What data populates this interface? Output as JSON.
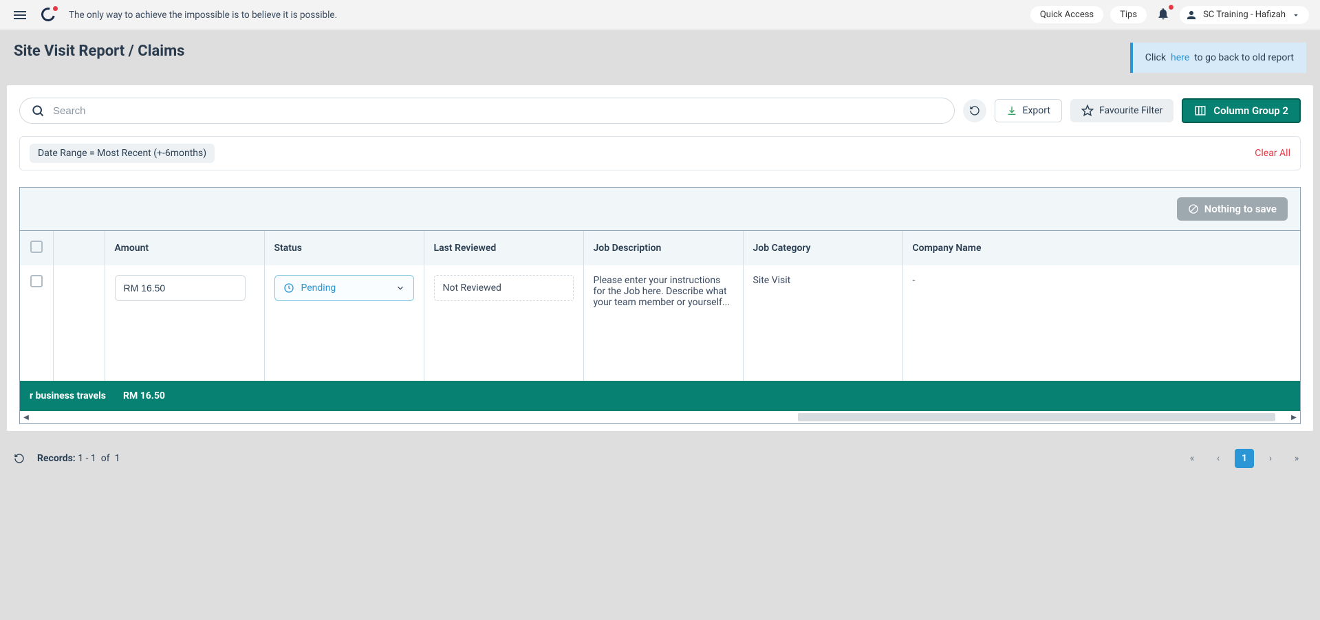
{
  "topbar": {
    "tagline": "The only way to achieve the impossible is to believe it is possible.",
    "quick_access": "Quick Access",
    "tips": "Tips",
    "user_label": "SC Training - Hafizah"
  },
  "page": {
    "title": "Site Visit Report / Claims",
    "notice_pre": "Click",
    "notice_link": "here",
    "notice_post": "to go back to old report"
  },
  "toolbar": {
    "search_placeholder": "Search",
    "export": "Export",
    "favourite": "Favourite Filter",
    "column_group": "Column Group 2"
  },
  "filters": {
    "chip": "Date Range  =  Most Recent (+-6months)",
    "clear": "Clear All"
  },
  "savebar": {
    "nothing_to_save": "Nothing to save"
  },
  "table": {
    "headers": {
      "amount": "Amount",
      "status": "Status",
      "last_reviewed": "Last Reviewed",
      "job_desc": "Job Description",
      "job_cat": "Job Category",
      "company": "Company Name"
    },
    "row": {
      "amount": "RM 16.50",
      "status": "Pending",
      "last_reviewed": "Not Reviewed",
      "job_desc": "Please enter your instructions for the Job here. Describe what your team member or yourself...",
      "job_cat": "Site Visit",
      "company": "-"
    },
    "total": {
      "label_fragment": "r business travels",
      "amount": "RM 16.50"
    }
  },
  "footer": {
    "records_label": "Records:",
    "records_range": "1 - 1",
    "records_of": "of",
    "records_total": "1",
    "page": "1"
  }
}
